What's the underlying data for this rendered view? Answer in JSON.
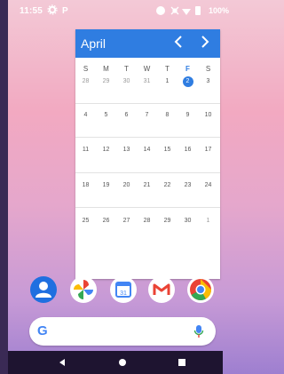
{
  "status_bar": {
    "time": "11:55",
    "battery_text": "100%"
  },
  "calendar": {
    "month": "April",
    "weekday_headers": [
      "S",
      "M",
      "T",
      "W",
      "T",
      "F",
      "S"
    ],
    "weeks": [
      [
        "28",
        "29",
        "30",
        "31",
        "1",
        "2",
        "3"
      ],
      [
        "4",
        "5",
        "6",
        "7",
        "8",
        "9",
        "10"
      ],
      [
        "11",
        "12",
        "13",
        "14",
        "15",
        "16",
        "17"
      ],
      [
        "18",
        "19",
        "20",
        "21",
        "22",
        "23",
        "24"
      ],
      [
        "25",
        "26",
        "27",
        "28",
        "29",
        "30",
        "1"
      ]
    ],
    "today": "2",
    "accent_color": "#2f7de1"
  },
  "dock": {
    "apps": [
      "Contacts",
      "Photos",
      "Calendar",
      "Gmail",
      "Chrome"
    ],
    "calendar_icon_day": "31"
  },
  "search": {
    "g_logo": "G",
    "icon": "mic-icon"
  }
}
